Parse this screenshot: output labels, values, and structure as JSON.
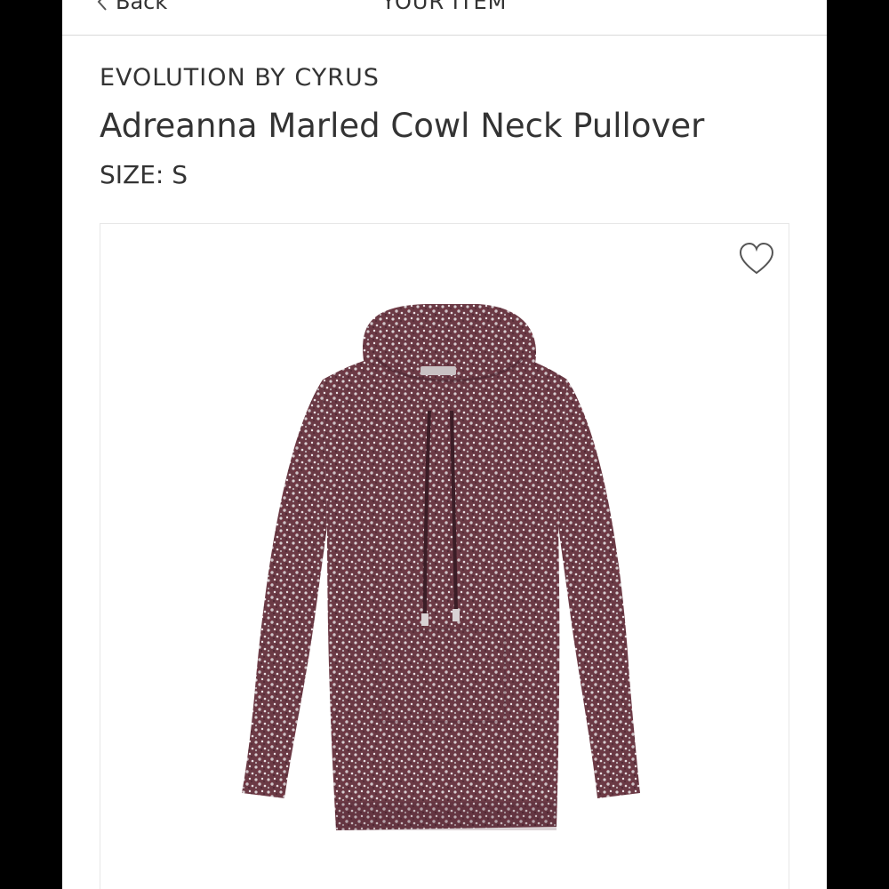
{
  "header": {
    "back_label": "Back",
    "title": "YOUR ITEM"
  },
  "product": {
    "brand": "EVOLUTION BY CYRUS",
    "name": "Adreanna Marled Cowl Neck Pullover",
    "size_label": "SIZE:",
    "size_value": "S",
    "image_icon": "sweater-image",
    "favorite_icon": "heart-icon",
    "colors": {
      "sweater_base": "#6b3a45",
      "sweater_dark": "#4a2530",
      "fleck": "#d8cfd2"
    }
  },
  "colors": {
    "text": "#333333",
    "divider": "#d9d9d9",
    "background": "#ffffff",
    "letterbox": "#000000"
  }
}
